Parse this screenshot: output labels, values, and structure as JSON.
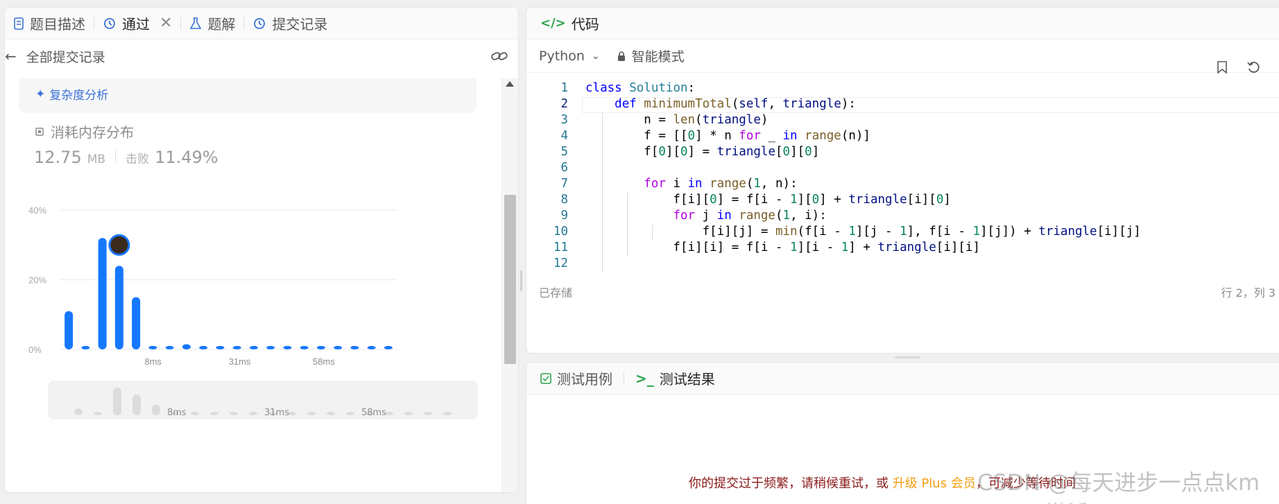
{
  "left": {
    "tabs": [
      {
        "label": "题目描述",
        "icon": "document-icon"
      },
      {
        "label": "通过",
        "icon": "history-icon",
        "active": true,
        "closable": true
      },
      {
        "label": "题解",
        "icon": "flask-icon"
      },
      {
        "label": "提交记录",
        "icon": "history-icon"
      }
    ],
    "back_label": "全部提交记录",
    "complexity_link": "复杂度分析",
    "memory": {
      "title": "消耗内存分布",
      "value": "12.75",
      "unit": "MB",
      "beat_label": "击败",
      "beat_value": "11.49%"
    }
  },
  "chart_data": {
    "type": "bar",
    "yticks": [
      "40%",
      "20%",
      "0%"
    ],
    "xtick_labels": [
      "8ms",
      "31ms",
      "58ms"
    ],
    "ylim": [
      0,
      40
    ],
    "values": [
      11,
      1,
      32,
      24,
      15,
      1,
      1,
      1.5,
      1,
      1,
      1,
      1,
      1,
      1,
      1,
      1,
      1,
      1,
      1,
      1
    ],
    "highlight_index": 3,
    "mini_values": [
      2,
      1,
      8,
      6,
      3,
      0.5,
      0.5,
      0.5,
      0.5,
      0.5,
      0.5,
      0.5,
      0.5,
      0.5,
      0.5,
      0.5,
      0.5,
      0.5,
      0.5,
      0.5
    ],
    "mini_labels": [
      "8ms",
      "31ms",
      "58ms"
    ],
    "bar_color": "#1677ff"
  },
  "code": {
    "header": "代码",
    "language": "Python",
    "mode": "智能模式",
    "lines": [
      "class Solution:",
      "    def minimumTotal(self, triangle):",
      "        n = len(triangle)",
      "        f = [[0] * n for _ in range(n)]",
      "        f[0][0] = triangle[0][0]",
      "",
      "        for i in range(1, n):",
      "            f[i][0] = f[i - 1][0] + triangle[i][0]",
      "            for j in range(1, i):",
      "                f[i][j] = min(f[i - 1][j - 1], f[i - 1][j]) + triangle[i][j]",
      "            f[i][i] = f[i - 1][i - 1] + triangle[i][i]",
      ""
    ],
    "saved": "已存储",
    "cursor": "行 2，列 3"
  },
  "test": {
    "tab1": "测试用例",
    "tab2": "测试结果",
    "notice_pre": "你的提交过于频繁，请稍候重试，或 ",
    "notice_plus": "升级 Plus 会员",
    "notice_post": "，可减少等待时间",
    "watermark": "CSDN @每天进步一点点km",
    "watermark2": "激活 Windows"
  }
}
